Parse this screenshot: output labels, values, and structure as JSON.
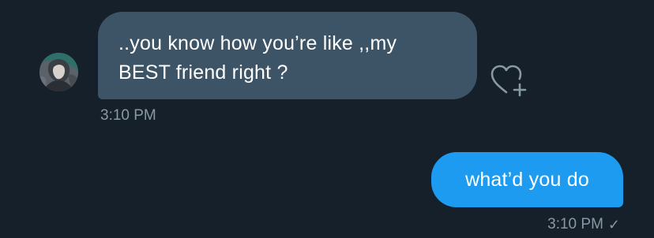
{
  "conversation": {
    "received": {
      "avatar_icon": "user-avatar",
      "text": "..you know how you’re like ,,my\nBEST friend right ?",
      "time": "3:10 PM",
      "react_icon": "heart-plus-icon"
    },
    "sent": {
      "text": "what’d you do",
      "time": "3:10 PM",
      "status_icon": "check-icon"
    }
  },
  "colors": {
    "background": "#15202b",
    "received_bubble": "#3d5466",
    "sent_bubble": "#1d9bf0",
    "timestamp": "#8899a6"
  }
}
